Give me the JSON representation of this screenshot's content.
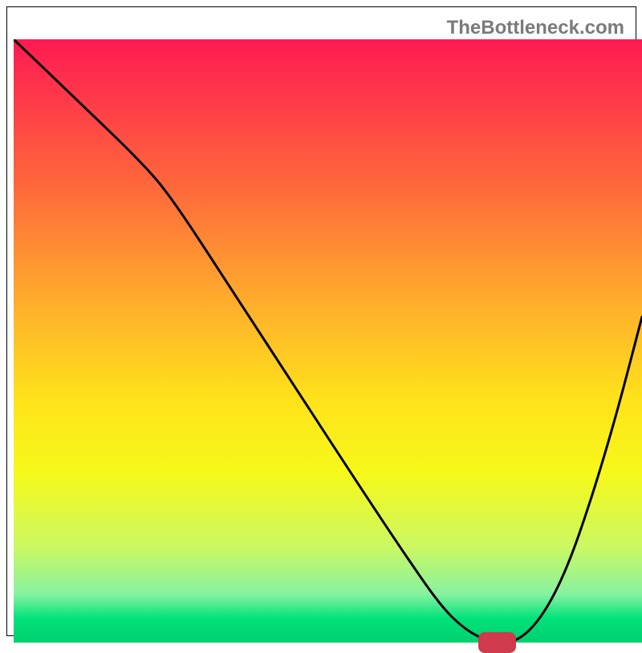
{
  "watermark": "TheBottleneck.com",
  "chart_data": {
    "type": "line",
    "title": "",
    "xlabel": "",
    "ylabel": "",
    "xlim": [
      0,
      100
    ],
    "ylim": [
      0,
      100
    ],
    "x": [
      0,
      10,
      20,
      25,
      35,
      45,
      55,
      62,
      68,
      72,
      76,
      80,
      84,
      88,
      92,
      96,
      100
    ],
    "y": [
      100,
      90,
      80,
      74,
      58,
      42,
      26,
      15,
      6,
      2,
      0,
      0,
      4,
      12,
      24,
      38,
      54
    ],
    "marker": {
      "x": 77,
      "y": 0,
      "width": 6,
      "height": 2
    },
    "gradient_stops": [
      {
        "pos": 0,
        "color": "#ff1a52"
      },
      {
        "pos": 10,
        "color": "#ff3a49"
      },
      {
        "pos": 25,
        "color": "#ff6a3a"
      },
      {
        "pos": 45,
        "color": "#ffb22b"
      },
      {
        "pos": 60,
        "color": "#ffe31a"
      },
      {
        "pos": 72,
        "color": "#f6f91a"
      },
      {
        "pos": 84,
        "color": "#ccf862"
      },
      {
        "pos": 92,
        "color": "#86f2a0"
      },
      {
        "pos": 96,
        "color": "#00e27a"
      },
      {
        "pos": 100,
        "color": "#00d070"
      }
    ]
  }
}
